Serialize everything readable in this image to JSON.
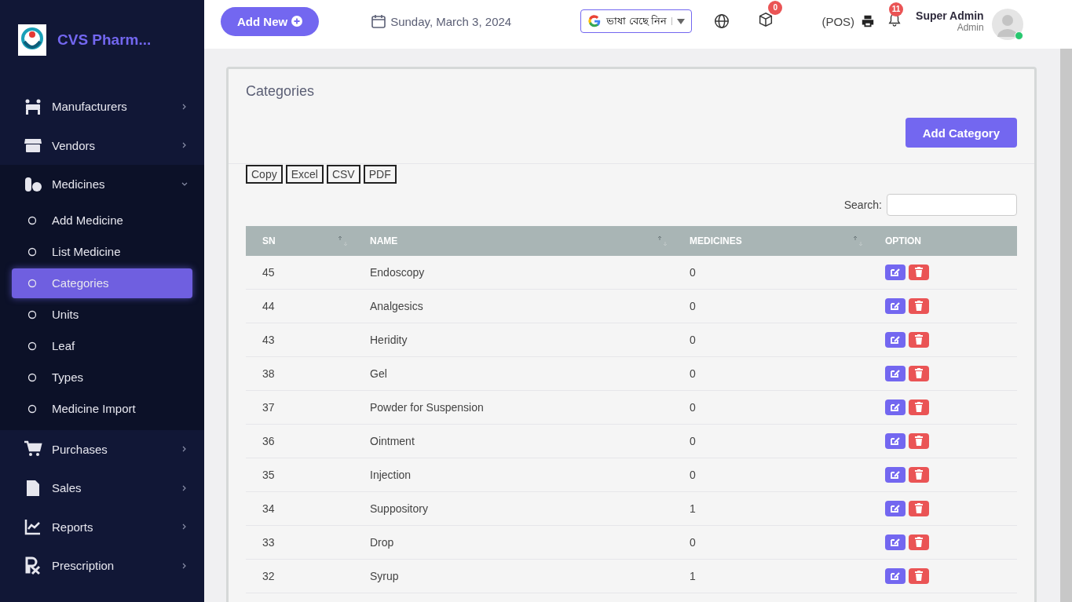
{
  "brand": {
    "name": "CVS Pharm..."
  },
  "sidebar": {
    "items": [
      {
        "label": "Manufacturers",
        "expanded": false
      },
      {
        "label": "Vendors",
        "expanded": false
      },
      {
        "label": "Medicines",
        "expanded": true,
        "children": [
          {
            "label": "Add Medicine",
            "selected": false
          },
          {
            "label": "List Medicine",
            "selected": false
          },
          {
            "label": "Categories",
            "selected": true
          },
          {
            "label": "Units",
            "selected": false
          },
          {
            "label": "Leaf",
            "selected": false
          },
          {
            "label": "Types",
            "selected": false
          },
          {
            "label": "Medicine Import",
            "selected": false
          }
        ]
      },
      {
        "label": "Purchases",
        "expanded": false
      },
      {
        "label": "Sales",
        "expanded": false
      },
      {
        "label": "Reports",
        "expanded": false
      },
      {
        "label": "Prescription",
        "expanded": false
      }
    ]
  },
  "header": {
    "add_new": "Add New",
    "date": "Sunday, March 3, 2024",
    "language": "ভাষা বেছে নিন",
    "cart_badge": "0",
    "pos": "(POS)",
    "notification_badge": "11",
    "user_name": "Super Admin",
    "user_role": "Admin",
    "online": true
  },
  "page": {
    "title": "Categories",
    "add_button": "Add Category",
    "export_buttons": [
      "Copy",
      "Excel",
      "CSV",
      "PDF"
    ],
    "search_label": "Search:"
  },
  "table": {
    "columns": [
      "SN",
      "NAME",
      "MEDICINES",
      "OPTION"
    ],
    "rows": [
      [
        "45",
        "Endoscopy",
        "0"
      ],
      [
        "44",
        "Analgesics",
        "0"
      ],
      [
        "43",
        "Heridity",
        "0"
      ],
      [
        "38",
        "Gel",
        "0"
      ],
      [
        "37",
        "Powder for Suspension",
        "0"
      ],
      [
        "36",
        "Ointment",
        "0"
      ],
      [
        "35",
        "Injection",
        "0"
      ],
      [
        "34",
        "Suppository",
        "1"
      ],
      [
        "33",
        "Drop",
        "0"
      ],
      [
        "32",
        "Syrup",
        "1"
      ]
    ]
  }
}
